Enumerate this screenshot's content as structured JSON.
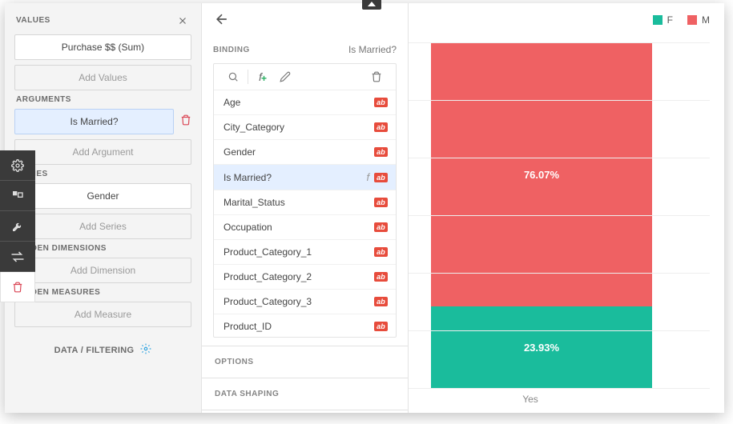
{
  "left": {
    "title_values": "VALUES",
    "value_item": "Purchase $$ (Sum)",
    "add_values": "Add Values",
    "title_arguments": "ARGUMENTS",
    "argument_item": "Is Married?",
    "add_argument": "Add Argument",
    "title_series": "SERIES",
    "series_item": "Gender",
    "add_series": "Add Series",
    "title_hidden_dim": "HIDDEN DIMENSIONS",
    "add_dimension": "Add Dimension",
    "title_hidden_meas": "HIDDEN MEASURES",
    "add_measure": "Add Measure",
    "data_filtering": "DATA / FILTERING"
  },
  "mid": {
    "binding_title": "BINDING",
    "binding_current": "Is Married?",
    "options_title": "OPTIONS",
    "data_shaping_title": "DATA SHAPING",
    "fields": [
      {
        "name": "Age",
        "selected": false,
        "calc": false
      },
      {
        "name": "City_Category",
        "selected": false,
        "calc": false
      },
      {
        "name": "Gender",
        "selected": false,
        "calc": false
      },
      {
        "name": "Is Married?",
        "selected": true,
        "calc": true
      },
      {
        "name": "Marital_Status",
        "selected": false,
        "calc": false
      },
      {
        "name": "Occupation",
        "selected": false,
        "calc": false
      },
      {
        "name": "Product_Category_1",
        "selected": false,
        "calc": false
      },
      {
        "name": "Product_Category_2",
        "selected": false,
        "calc": false
      },
      {
        "name": "Product_Category_3",
        "selected": false,
        "calc": false
      },
      {
        "name": "Product_ID",
        "selected": false,
        "calc": false
      }
    ]
  },
  "chart_data": {
    "type": "bar",
    "stacked": true,
    "categories": [
      "Yes"
    ],
    "series": [
      {
        "name": "F",
        "values": [
          23.93
        ],
        "color": "#1abc9c"
      },
      {
        "name": "M",
        "values": [
          76.07
        ],
        "color": "#ef6163"
      }
    ],
    "legend": [
      "F",
      "M"
    ],
    "ylim": [
      0,
      100
    ],
    "gridlines": 6,
    "value_suffix": "%",
    "xlabel": "",
    "ylabel": "",
    "title": ""
  }
}
